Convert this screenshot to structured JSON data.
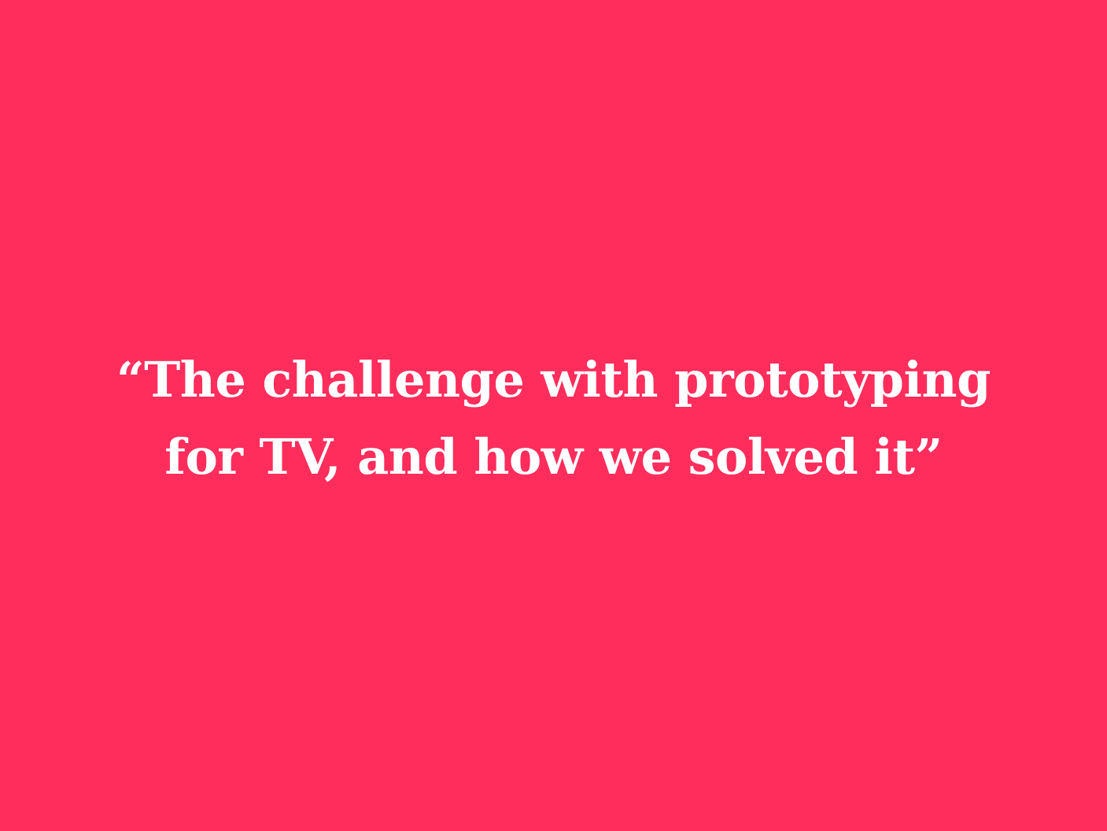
{
  "slide": {
    "background_color": "#FF2D5C",
    "text_color": "#FFFFFF",
    "quote_lines": [
      "“The challenge with prototyping",
      "for TV, and how we solved it”"
    ]
  }
}
